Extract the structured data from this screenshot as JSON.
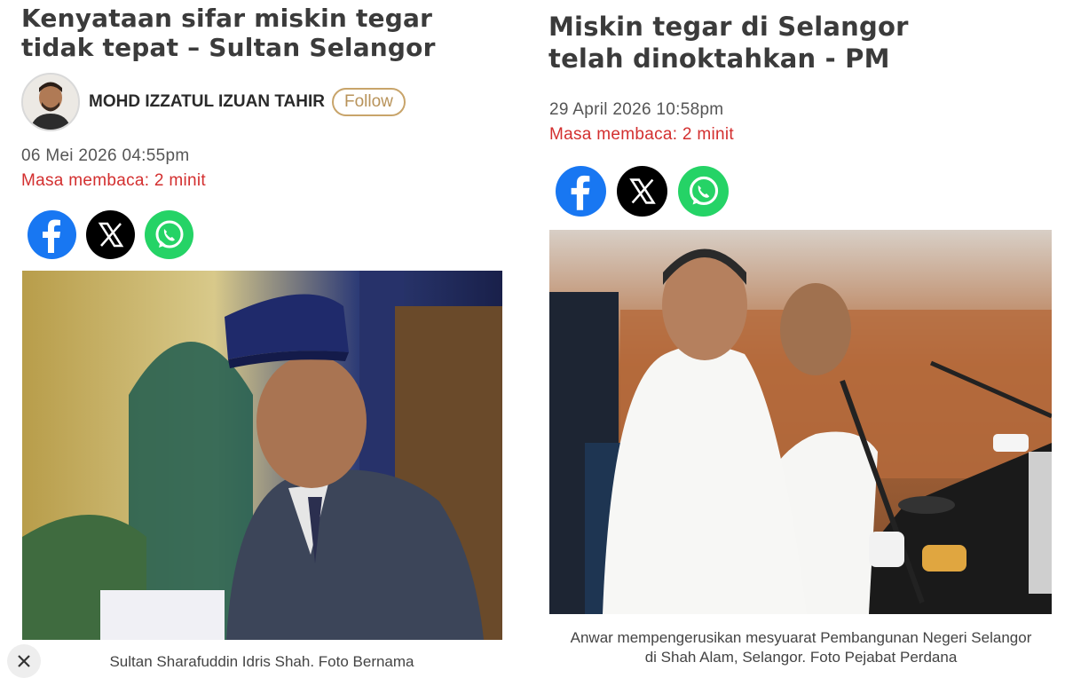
{
  "left_article": {
    "headline": "Kenyataan sifar miskin tegar tidak tepat – Sultan Selangor",
    "author_name": "MOHD IZZATUL IZUAN TAHIR",
    "follow_label": "Follow",
    "date": "06 Mei 2026 04:55pm",
    "read_time": "Masa membaca: 2 minit",
    "caption": "Sultan Sharafuddin Idris Shah. Foto Bernama"
  },
  "right_article": {
    "headline": "Miskin tegar di Selangor telah dinoktahkan - PM",
    "date": "29 April 2026 10:58pm",
    "read_time": "Masa membaca: 2 minit",
    "caption": "Anwar mempengerusikan mesyuarat Pembangunan Negeri Selangor di Shah Alam, Selangor. Foto Pejabat Perdana"
  },
  "share_icons": [
    "facebook-icon",
    "x-icon",
    "whatsapp-icon"
  ],
  "colors": {
    "facebook": "#1877f2",
    "x": "#000000",
    "whatsapp": "#25d366",
    "read_time": "#d32f2f",
    "follow_border": "#c8a46a"
  }
}
